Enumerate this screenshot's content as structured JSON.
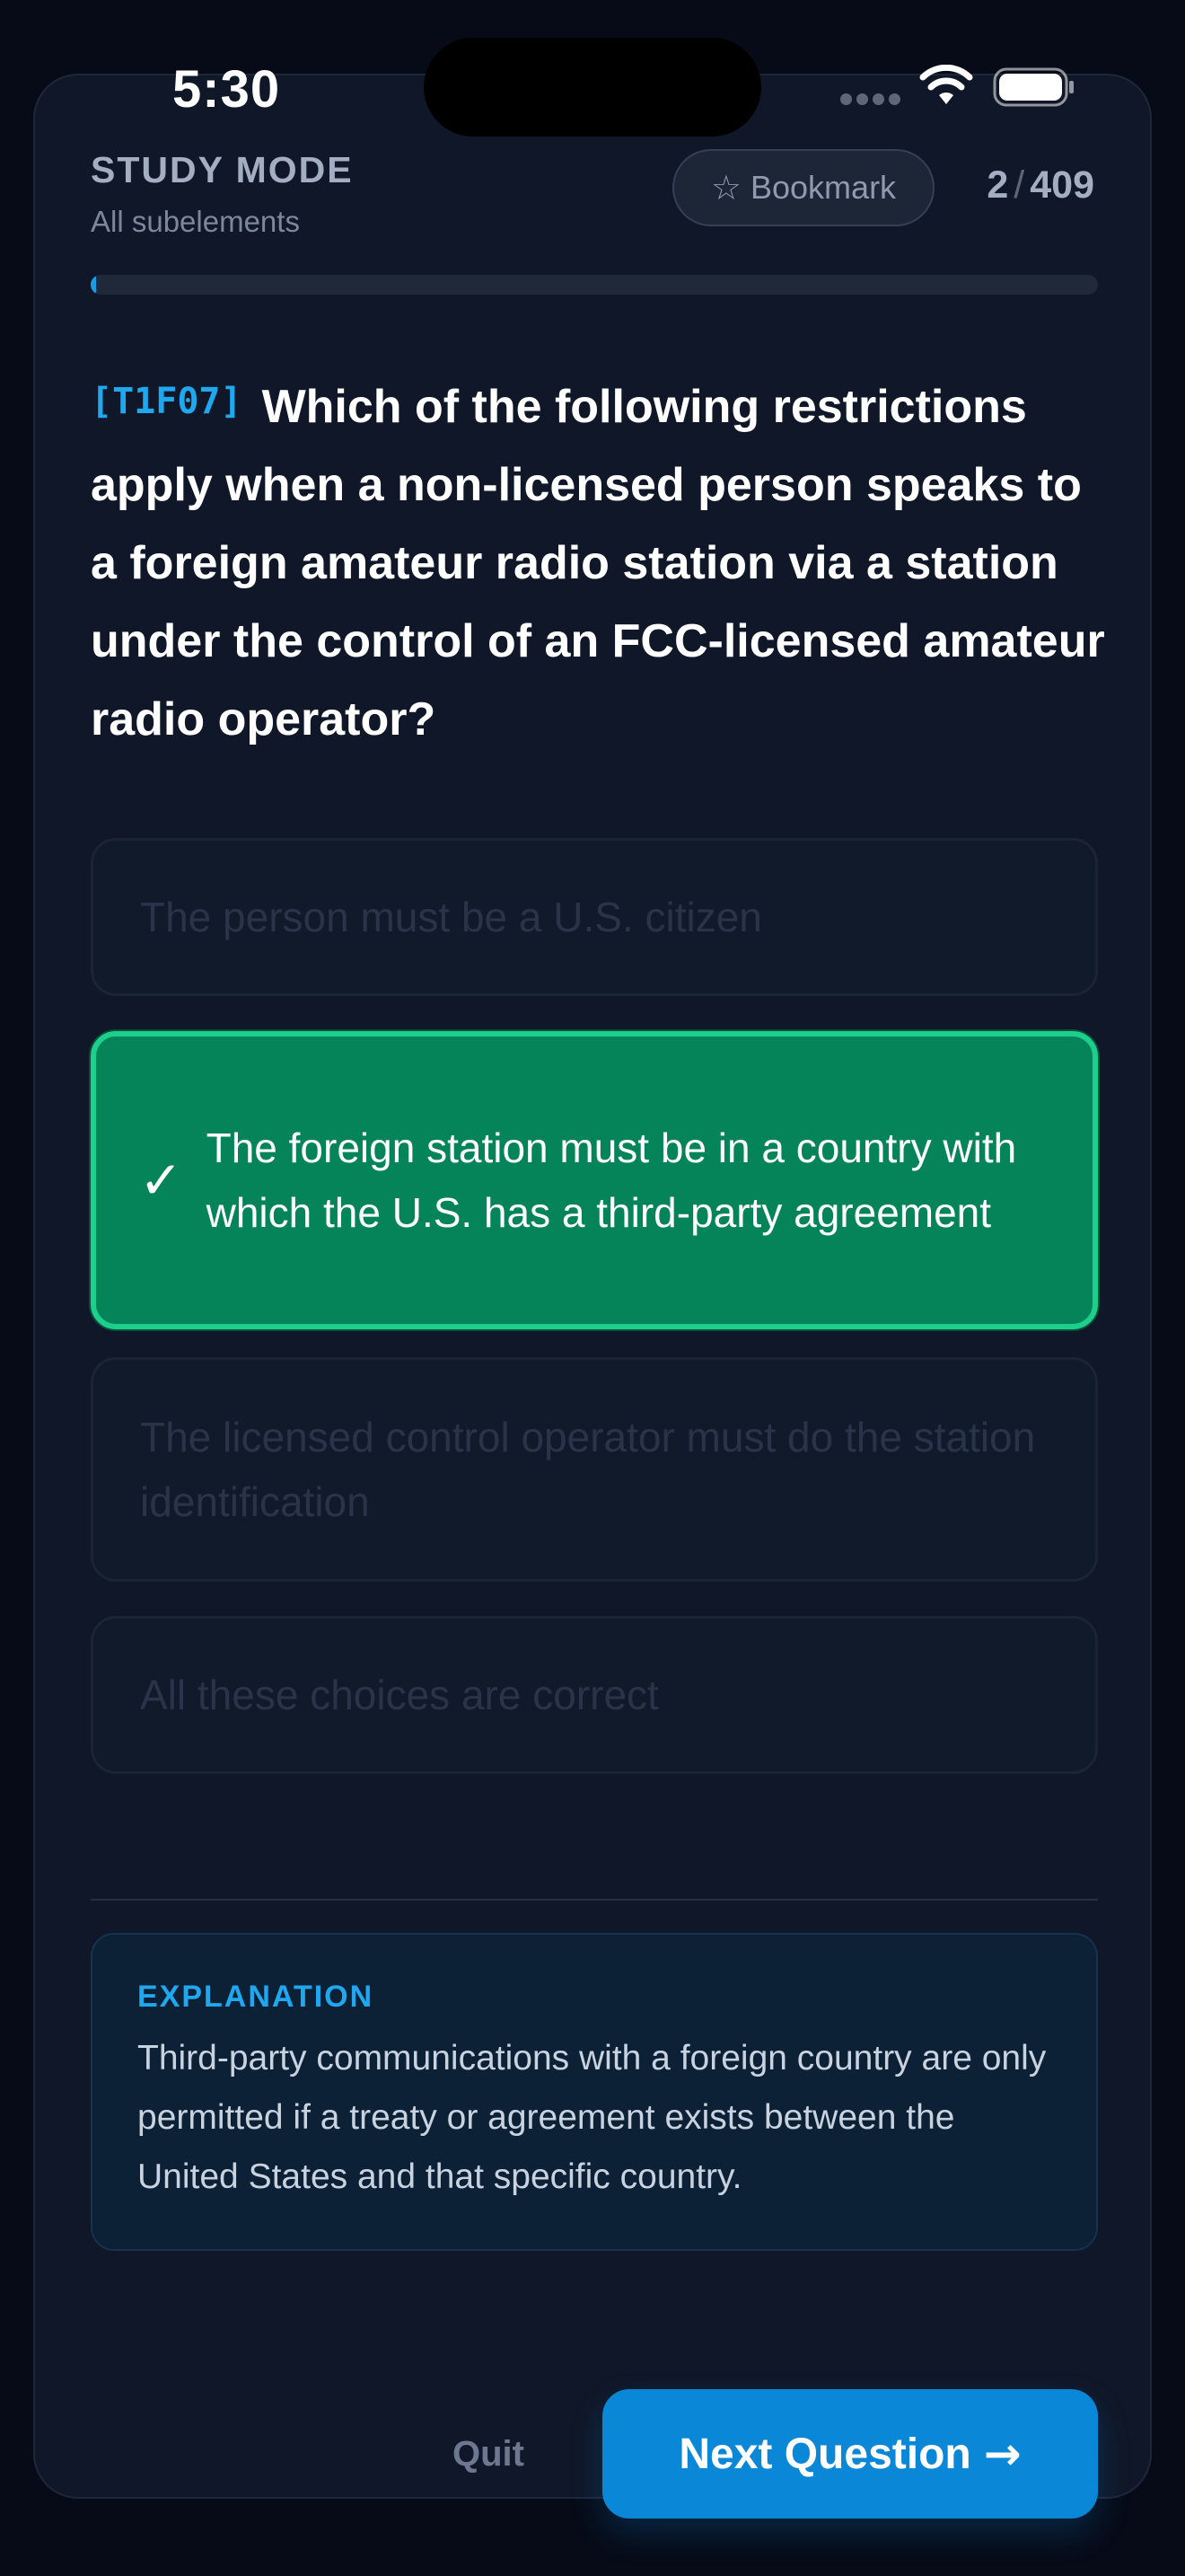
{
  "status_bar": {
    "time": "5:30"
  },
  "header": {
    "mode_title": "STUDY MODE",
    "mode_subtitle": "All subelements",
    "bookmark_label": "Bookmark",
    "bookmark_icon": "star-outline-icon",
    "counter_current": "2",
    "counter_separator": "/",
    "counter_total": "409",
    "progress_fraction": 0.0049
  },
  "question": {
    "code": "[T1F07]",
    "text": "Which of the following restrictions apply when a non-licensed person speaks to a foreign amateur radio station via a station under the control of an FCC-licensed amateur radio operator?"
  },
  "answers": [
    {
      "text": "The person must be a U.S. citizen",
      "state": "dimmed"
    },
    {
      "text": "The foreign station must be in a country with which the U.S. has a third-party agreement",
      "state": "correct",
      "icon": "✓"
    },
    {
      "text": "The licensed control operator must do the station identification",
      "state": "dimmed"
    },
    {
      "text": "All these choices are correct",
      "state": "dimmed"
    }
  ],
  "explanation": {
    "label": "EXPLANATION",
    "text": "Third-party communications with a foreign country are only permitted if a treaty or agreement exists between the United States and that specific country."
  },
  "footer": {
    "quit_label": "Quit",
    "next_label": "Next Question",
    "next_arrow": "→"
  },
  "colors": {
    "background": "#070b18",
    "card": "#101728",
    "accent": "#1ea8ef",
    "correct": "#05845a",
    "correct_border": "#1ccf8d",
    "primary_button": "#0a87d6"
  }
}
